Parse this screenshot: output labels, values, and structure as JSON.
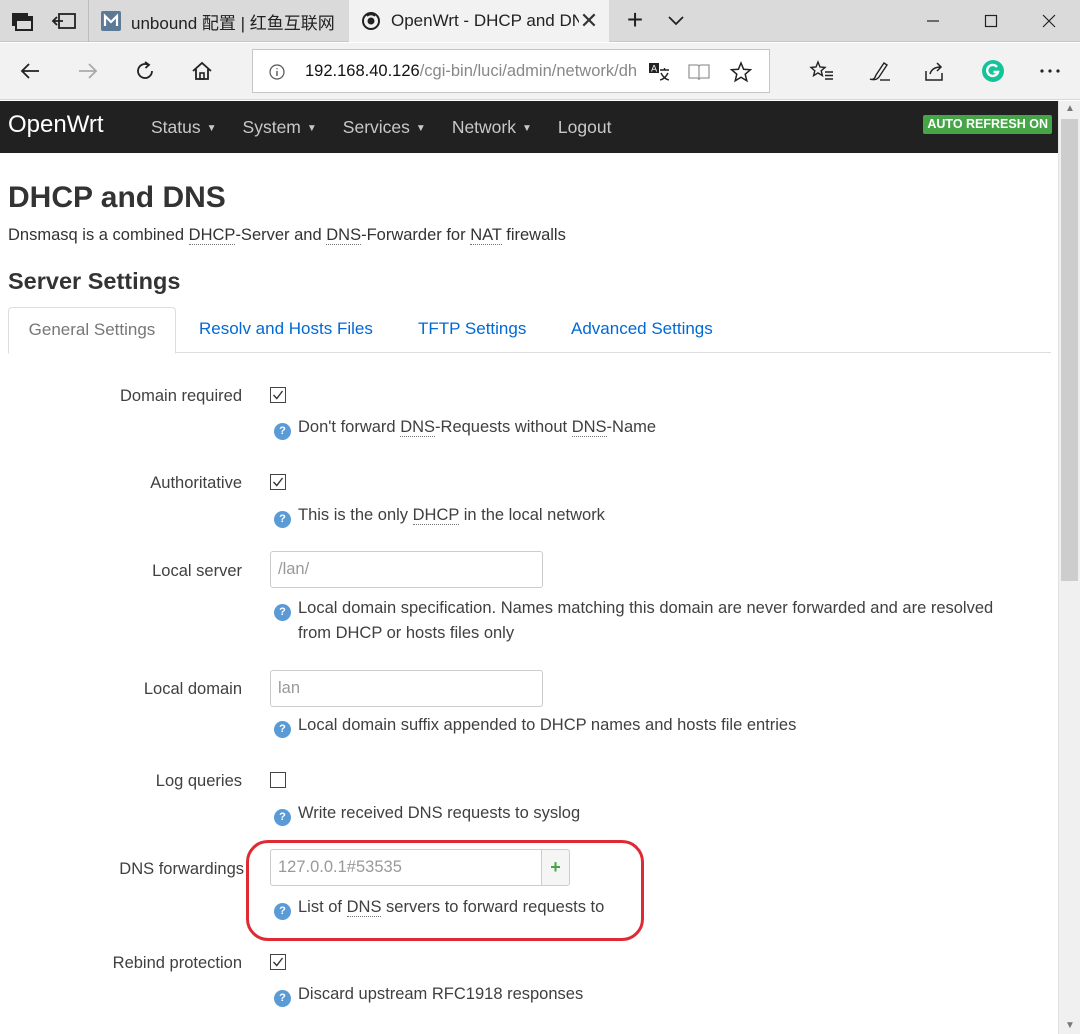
{
  "browser": {
    "tabs": [
      {
        "title": "unbound 配置 | 红鱼互联网",
        "favicon": "m-logo-icon"
      },
      {
        "title": "OpenWrt - DHCP and DNS - LuCI",
        "favicon": "openwrt-icon",
        "active": true
      }
    ],
    "url_host": "192.168.40.126",
    "url_path": "/cgi-bin/luci/admin/network/dhcp"
  },
  "luci": {
    "brand": "OpenWrt",
    "nav": [
      "Status",
      "System",
      "Services",
      "Network",
      "Logout"
    ],
    "autorefresh": "AUTO REFRESH ON",
    "page_title": "DHCP and DNS",
    "desc": {
      "a": "Dnsmasq is a combined ",
      "dhcp": "DHCP",
      "b": "-Server and ",
      "dns": "DNS",
      "c": "-Forwarder for ",
      "nat": "NAT",
      "d": " firewalls"
    },
    "section_title": "Server Settings",
    "tabs": [
      "General Settings",
      "Resolv and Hosts Files",
      "TFTP Settings",
      "Advanced Settings"
    ]
  },
  "fields": {
    "domain_required": {
      "label": "Domain required",
      "checked": true,
      "help_a": "Don't forward ",
      "help_abbr": "DNS",
      "help_b": "-Requests without ",
      "help_abbr2": "DNS",
      "help_c": "-Name"
    },
    "authoritative": {
      "label": "Authoritative",
      "checked": true,
      "help_a": "This is the only ",
      "help_abbr": "DHCP",
      "help_b": " in the local network"
    },
    "local_server": {
      "label": "Local server",
      "placeholder": "/lan/",
      "help_line1": "Local domain specification. Names matching this domain are never forwarded and are resolved",
      "help_line2": "from DHCP or hosts files only"
    },
    "local_domain": {
      "label": "Local domain",
      "placeholder": "lan",
      "help": "Local domain suffix appended to DHCP names and hosts file entries"
    },
    "log_queries": {
      "label": "Log queries",
      "checked": false,
      "help": "Write received DNS requests to syslog"
    },
    "dns_forwardings": {
      "label": "DNS forwardings",
      "placeholder": "127.0.0.1#53535",
      "add_label": "+",
      "help_a": "List of ",
      "help_abbr": "DNS",
      "help_b": " servers to forward requests to"
    },
    "rebind_protection": {
      "label": "Rebind protection",
      "checked": true,
      "help": "Discard upstream RFC1918 responses"
    }
  },
  "colors": {
    "header_bg": "#212121",
    "link": "#0069d6",
    "badge_green": "#46a546",
    "highlight_red": "#e02a33",
    "help_icon": "#5b9bd5"
  }
}
